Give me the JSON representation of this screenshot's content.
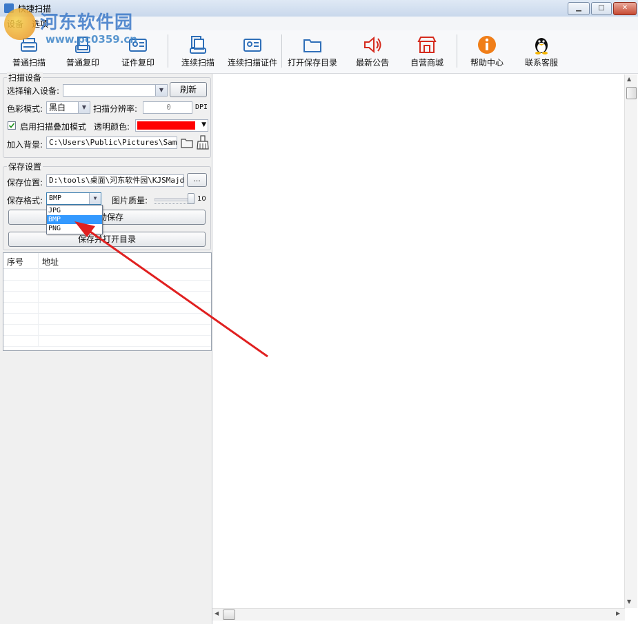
{
  "window": {
    "title": "快捷扫描",
    "minimize": "▁",
    "maximize": "□",
    "close": "✕"
  },
  "watermark": {
    "name": "河东软件园",
    "url": "www.pc0359.cn"
  },
  "menu": [
    "设备",
    "选项"
  ],
  "toolbar": [
    {
      "label": "普通扫描",
      "icon": "scanner-icon"
    },
    {
      "label": "普通复印",
      "icon": "copy-icon"
    },
    {
      "label": "证件复印",
      "icon": "id-card-icon"
    },
    {
      "label": "连续扫描",
      "icon": "continuous-scan-icon"
    },
    {
      "label": "连续扫描证件",
      "icon": "continuous-id-scan-icon"
    },
    {
      "label": "打开保存目录",
      "icon": "folder-icon"
    },
    {
      "label": "最新公告",
      "icon": "speaker-icon"
    },
    {
      "label": "自营商城",
      "icon": "store-icon"
    },
    {
      "label": "帮助中心",
      "icon": "info-icon"
    },
    {
      "label": "联系客服",
      "icon": "qq-penguin-icon"
    }
  ],
  "scan_settings": {
    "group_title": "扫描设备",
    "device_label": "选择输入设备:",
    "device_value": "",
    "refresh": "刷新",
    "color_mode_label": "色彩模式:",
    "color_mode_value": "黑白",
    "resolution_label": "扫描分辨率:",
    "resolution_value": "0",
    "dpi": "DPI",
    "overlay_checkbox": "启用扫描叠加模式",
    "overlay_checked": true,
    "transparent_label": "透明颜色:",
    "transparent_color": "#ff0000",
    "background_label": "加入背景:",
    "background_path": "C:\\Users\\Public\\Pictures\\Sample"
  },
  "save_settings": {
    "group_title": "保存设置",
    "location_label": "保存位置:",
    "location_value": "D:\\tools\\桌面\\河东软件园\\KJSMajdj",
    "browse": "...",
    "format_label": "保存格式:",
    "format_value": "BMP",
    "quality_label": "图片质量:",
    "quality_value": "10",
    "auto_save_button": "自动保存",
    "save_open_button": "保存并打开目录",
    "format_options": [
      "JPG",
      "BMP",
      "PNG"
    ],
    "selected_option": "BMP"
  },
  "list": {
    "columns": [
      "序号",
      "地址"
    ],
    "rows": []
  },
  "colors": {
    "accent": "#3399ff",
    "arrow": "#e02020",
    "selected": "#3399ff"
  }
}
